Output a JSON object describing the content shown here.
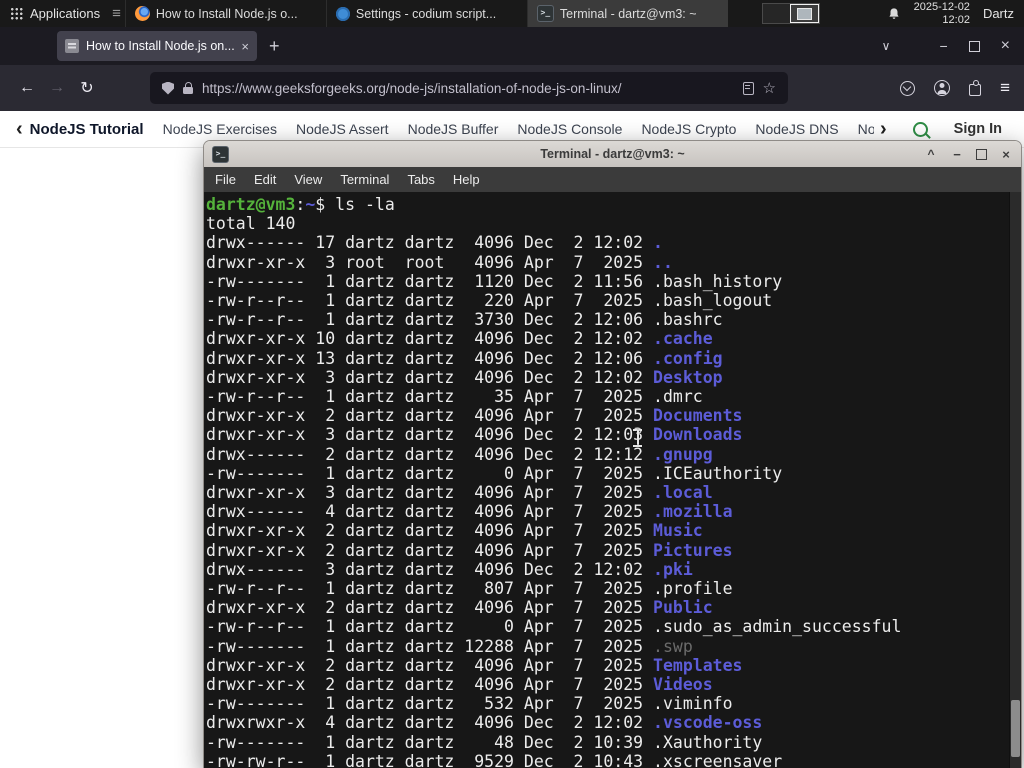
{
  "colors": {
    "prompt_green": "#55b33b",
    "directory_blue": "#5c5cd8",
    "file_white": "#ececec",
    "dim_grey": "#6b6b6b",
    "gfg_green": "#2f8d46"
  },
  "icons": {
    "hamburger": "≡",
    "back_arrow": "←",
    "forward_arrow": "→",
    "reload": "↻",
    "star": "☆",
    "new_tab": "+",
    "close": "×",
    "minimize": "−",
    "shade": "^",
    "list_tabs": "∨",
    "chevron_left": "‹",
    "chevron_right": "›"
  },
  "panel": {
    "applications_label": "Applications",
    "windows": [
      {
        "icon": "firefox-icon",
        "label": "How to Install Node.js o...",
        "active": false
      },
      {
        "icon": "settings-icon",
        "label": "Settings - codium script...",
        "active": false
      },
      {
        "icon": "terminal-icon",
        "label": "Terminal - dartz@vm3: ~",
        "active": true
      }
    ],
    "clock": {
      "date": "2025-12-02",
      "time": "12:02"
    },
    "user_label": "Dartz"
  },
  "browser": {
    "tab_title": "How to Install Node.js on...",
    "url": "https://www.geeksforgeeks.org/node-js/installation-of-node-js-on-linux/"
  },
  "site_nav": {
    "primary_label": "NodeJS Tutorial",
    "links": [
      "NodeJS Exercises",
      "NodeJS Assert",
      "NodeJS Buffer",
      "NodeJS Console",
      "NodeJS Crypto",
      "NodeJS DNS",
      "Node"
    ],
    "sign_in_label": "Sign In"
  },
  "terminal": {
    "window_title": "Terminal - dartz@vm3: ~",
    "menu_items": [
      "File",
      "Edit",
      "View",
      "Terminal",
      "Tabs",
      "Help"
    ],
    "prompt_user_host": "dartz@vm3",
    "prompt_separator": ":",
    "prompt_path": "~",
    "prompt_symbol": "$",
    "command": "ls -la",
    "total_line": "total 140",
    "listing": [
      {
        "meta": "drwx------ 17 dartz dartz  4096 Dec  2 12:02 ",
        "name": ".",
        "type": "dir"
      },
      {
        "meta": "drwxr-xr-x  3 root  root   4096 Apr  7  2025 ",
        "name": "..",
        "type": "dir"
      },
      {
        "meta": "-rw-------  1 dartz dartz  1120 Dec  2 11:56 ",
        "name": ".bash_history",
        "type": "file"
      },
      {
        "meta": "-rw-r--r--  1 dartz dartz   220 Apr  7  2025 ",
        "name": ".bash_logout",
        "type": "file"
      },
      {
        "meta": "-rw-r--r--  1 dartz dartz  3730 Dec  2 12:06 ",
        "name": ".bashrc",
        "type": "file"
      },
      {
        "meta": "drwxr-xr-x 10 dartz dartz  4096 Dec  2 12:02 ",
        "name": ".cache",
        "type": "dir"
      },
      {
        "meta": "drwxr-xr-x 13 dartz dartz  4096 Dec  2 12:06 ",
        "name": ".config",
        "type": "dir"
      },
      {
        "meta": "drwxr-xr-x  3 dartz dartz  4096 Dec  2 12:02 ",
        "name": "Desktop",
        "type": "dir"
      },
      {
        "meta": "-rw-r--r--  1 dartz dartz    35 Apr  7  2025 ",
        "name": ".dmrc",
        "type": "file"
      },
      {
        "meta": "drwxr-xr-x  2 dartz dartz  4096 Apr  7  2025 ",
        "name": "Documents",
        "type": "dir"
      },
      {
        "meta": "drwxr-xr-x  3 dartz dartz  4096 Dec  2 12:03 ",
        "name": "Downloads",
        "type": "dir"
      },
      {
        "meta": "drwx------  2 dartz dartz  4096 Dec  2 12:12 ",
        "name": ".gnupg",
        "type": "dir"
      },
      {
        "meta": "-rw-------  1 dartz dartz     0 Apr  7  2025 ",
        "name": ".ICEauthority",
        "type": "file"
      },
      {
        "meta": "drwxr-xr-x  3 dartz dartz  4096 Apr  7  2025 ",
        "name": ".local",
        "type": "dir"
      },
      {
        "meta": "drwx------  4 dartz dartz  4096 Apr  7  2025 ",
        "name": ".mozilla",
        "type": "dir"
      },
      {
        "meta": "drwxr-xr-x  2 dartz dartz  4096 Apr  7  2025 ",
        "name": "Music",
        "type": "dir"
      },
      {
        "meta": "drwxr-xr-x  2 dartz dartz  4096 Apr  7  2025 ",
        "name": "Pictures",
        "type": "dir"
      },
      {
        "meta": "drwx------  3 dartz dartz  4096 Dec  2 12:02 ",
        "name": ".pki",
        "type": "dir"
      },
      {
        "meta": "-rw-r--r--  1 dartz dartz   807 Apr  7  2025 ",
        "name": ".profile",
        "type": "file"
      },
      {
        "meta": "drwxr-xr-x  2 dartz dartz  4096 Apr  7  2025 ",
        "name": "Public",
        "type": "dir"
      },
      {
        "meta": "-rw-r--r--  1 dartz dartz     0 Apr  7  2025 ",
        "name": ".sudo_as_admin_successful",
        "type": "file"
      },
      {
        "meta": "-rw-------  1 dartz dartz 12288 Apr  7  2025 ",
        "name": ".swp",
        "type": "dim"
      },
      {
        "meta": "drwxr-xr-x  2 dartz dartz  4096 Apr  7  2025 ",
        "name": "Templates",
        "type": "dir"
      },
      {
        "meta": "drwxr-xr-x  2 dartz dartz  4096 Apr  7  2025 ",
        "name": "Videos",
        "type": "dir"
      },
      {
        "meta": "-rw-------  1 dartz dartz   532 Apr  7  2025 ",
        "name": ".viminfo",
        "type": "file"
      },
      {
        "meta": "drwxrwxr-x  4 dartz dartz  4096 Dec  2 12:02 ",
        "name": ".vscode-oss",
        "type": "dir"
      },
      {
        "meta": "-rw-------  1 dartz dartz    48 Dec  2 10:39 ",
        "name": ".Xauthority",
        "type": "file"
      },
      {
        "meta": "-rw-rw-r--  1 dartz dartz  9529 Dec  2 10:43 ",
        "name": ".xscreensaver",
        "type": "file"
      }
    ]
  }
}
